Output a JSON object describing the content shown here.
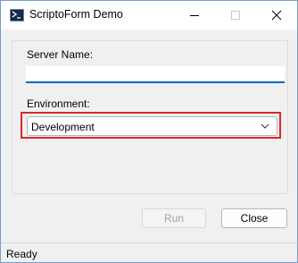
{
  "window": {
    "title": "ScriptoForm Demo",
    "icon": "powershell-icon",
    "controls": [
      "minimize-icon",
      "maximize-icon",
      "close-icon"
    ]
  },
  "form": {
    "server_label": "Server Name:",
    "server_value": "",
    "environment_label": "Environment:",
    "environment_value": "Development"
  },
  "buttons": {
    "run_label": "Run",
    "close_label": "Close"
  },
  "status": {
    "text": "Ready"
  },
  "colors": {
    "focus_underline": "#0067c0",
    "highlight_border": "#d8262b",
    "window_border": "#7a9cc6",
    "dialog_background": "#f0f0f0"
  }
}
